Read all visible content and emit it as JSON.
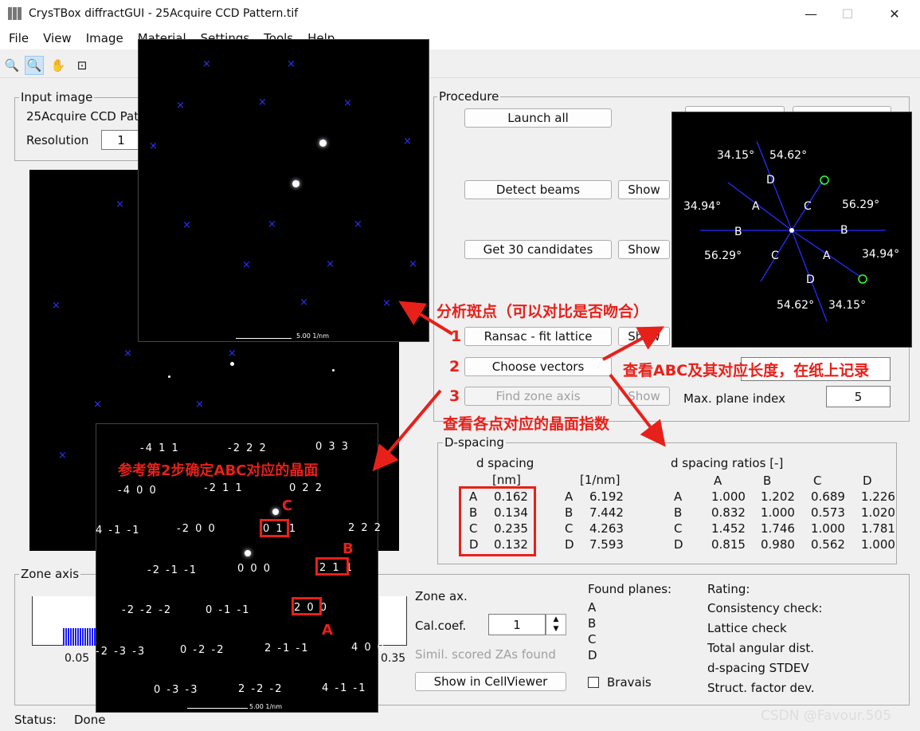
{
  "title": "CrysTBox diffractGUI - 25Acquire CCD Pattern.tif",
  "menu": [
    "File",
    "View",
    "Image",
    "Material",
    "Settings",
    "Tools",
    "Help"
  ],
  "input_image": {
    "legend": "Input image",
    "file": "25Acquire CCD Pat",
    "res_label": "Resolution",
    "res_value": "1"
  },
  "procedure": {
    "legend": "Procedure",
    "launch": "Launch all",
    "detect": "Detect beams",
    "candidates": "Get 30 candidates",
    "ransac": "Ransac - fit lattice",
    "choose": "Choose vectors",
    "findza": "Find zone axis",
    "show": "Show",
    "maxplane_label": "Max. plane index",
    "maxplane_value": "5"
  },
  "dspacing": {
    "legend": "D-spacing",
    "h1": "d spacing",
    "h1u": "[nm]",
    "h2u": "[1/nm]",
    "h3": "d spacing ratios [-]",
    "rows": [
      {
        "k": "A",
        "nm": "0.162",
        "inv": "6.192",
        "r": [
          "1.000",
          "1.202",
          "0.689",
          "1.226"
        ]
      },
      {
        "k": "B",
        "nm": "0.134",
        "inv": "7.442",
        "r": [
          "0.832",
          "1.000",
          "0.573",
          "1.020"
        ]
      },
      {
        "k": "C",
        "nm": "0.235",
        "inv": "4.263",
        "r": [
          "1.452",
          "1.746",
          "1.000",
          "1.781"
        ]
      },
      {
        "k": "D",
        "nm": "0.132",
        "inv": "7.593",
        "r": [
          "0.815",
          "0.980",
          "0.562",
          "1.000"
        ]
      }
    ],
    "cols": [
      "A",
      "B",
      "C",
      "D"
    ]
  },
  "zone": {
    "legend": "Zone axis",
    "zoneax": "Zone ax.",
    "calcoef": "Cal.coef.",
    "calcoef_val": "1",
    "simil": "Simil. scored ZAs found",
    "cellviewer": "Show in CellViewer",
    "found": "Found planes:",
    "planes": [
      "A",
      "B",
      "C",
      "D"
    ],
    "bravais": "Bravais",
    "rating": [
      "Rating:",
      "Consistency check:",
      "Lattice check",
      "Total angular dist.",
      "d-spacing STDEV",
      "Struct. factor dev."
    ],
    "axis_min": "0.05",
    "axis_max": "0.35"
  },
  "status": {
    "label": "Status:",
    "value": "Done"
  },
  "annotations": {
    "a1": "分析斑点（可以对比是否吻合）",
    "a2": "查看ABC及其对应长度，在纸上记录",
    "a3": "查看各点对应的晶面指数",
    "a4": "参考第2步确定ABC对应的晶面",
    "n1": "1",
    "n2": "2",
    "n3": "3"
  },
  "scale_label": "5.00 1/nm",
  "angles": [
    "34.15°",
    "54.62°",
    "34.94°",
    "56.29°",
    "56.29°",
    "34.94°",
    "54.62°",
    "34.15°"
  ],
  "vector_labels": [
    "D",
    "A",
    "C",
    "B",
    "B",
    "C",
    "A",
    "D"
  ],
  "indices": [
    "-4 1 1",
    "-2 2 2",
    "0 3 3",
    "-2 1 1",
    "0 2 2",
    "-4 0 0",
    "-2 0 0",
    "0 1 1",
    "2 2 2",
    "4 -1 -1",
    "2 1 1",
    "-2 -1 -1",
    "0 0 0",
    "2 0 0",
    "-2 -2 -2",
    "0 -1 -1",
    "-2 -3 -3",
    "0 -2 -2",
    "2 -1 -1",
    "4 0 0",
    "0 -3 -3",
    "2 -2 -2",
    "4 -1 -1"
  ],
  "marker_letters": [
    "C",
    "B",
    "A"
  ],
  "watermark": "CSDN @Favour.505"
}
